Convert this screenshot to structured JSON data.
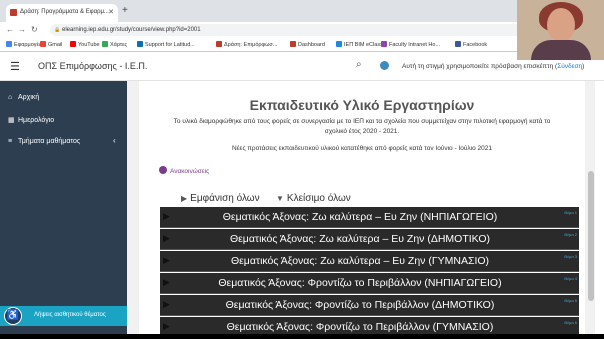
{
  "browser": {
    "tab_title": "Δράση: Προγράμματα & Εφαρμ...",
    "url": "elearning.iep.edu.gr/study/course/view.php?id=2001",
    "bookmarks": [
      {
        "label": "Εφαρμογές",
        "color": "#4285f4"
      },
      {
        "label": "Gmail",
        "color": "#ea4335"
      },
      {
        "label": "YouTube",
        "color": "#ff0000"
      },
      {
        "label": "Χάρτες",
        "color": "#34a853"
      },
      {
        "label": "Support for Latitud...",
        "color": "#0b6fb8"
      },
      {
        "label": "Δράση: Επιμόρφωσ...",
        "color": "#c0392b"
      },
      {
        "label": "Dashboard",
        "color": "#c0392b"
      },
      {
        "label": "ΙΕΠ ΒΙΜ eClass",
        "color": "#1e88e5"
      },
      {
        "label": "Faculty Intranet Ho...",
        "color": "#8e44ad"
      },
      {
        "label": "Facebook",
        "color": "#3b5998"
      }
    ]
  },
  "header": {
    "site_title": "ΟΠΣ Επιμόρφωσης - Ι.Ε.Π.",
    "guest_text": "Αυτή τη στιγμή χρησιμοποιείτε πρόσβαση επισκέπτη (",
    "login_link": "Σύνδεση",
    "guest_close": ")"
  },
  "sidebar": {
    "items": [
      {
        "label": "Αρχική",
        "icon": "home-icon"
      },
      {
        "label": "Ημερολόγιο",
        "icon": "calendar-icon"
      },
      {
        "label": "Τμήματα μαθήματος",
        "icon": "sections-icon"
      }
    ],
    "bottom_label": "Λήψεις αισθητικού θέματος"
  },
  "main": {
    "title": "Εκπαιδευτικό Υλικό Εργαστηρίων",
    "intro": "Το υλικό διαμορφώθηκε από τους φορείς σε συνεργασία με το ΙΕΠ και τα σχολεία που συμμετείχαν στην πιλοτική εφαρμογή κατά το σχολικό έτος 2020 - 2021.",
    "intro2": "Νέες προτάσεις εκπαιδευτικού υλικού κατατέθηκε από φορείς κατά τον Ιούνιο - Ιούλιο 2021",
    "announcements": "Ανακοινώσεις",
    "expand_all": "Εμφάνιση όλων",
    "collapse_all": "Κλείσιμο όλων",
    "sections": [
      {
        "label": "Θεματικός Άξονας: Ζω καλύτερα – Ευ Ζην (ΝΗΠΙΑΓΩΓΕΙΟ)",
        "meta": "Θέμα 1"
      },
      {
        "label": "Θεματικός Άξονας: Ζω καλύτερα – Ευ Ζην (ΔΗΜΟΤΙΚΟ)",
        "meta": "Θέμα 2"
      },
      {
        "label": "Θεματικός Άξονας: Ζω καλύτερα – Ευ Ζην (ΓΥΜΝΑΣΙΟ)",
        "meta": "Θέμα 3"
      },
      {
        "label": "Θεματικός Άξονας: Φροντίζω το Περιβάλλον (ΝΗΠΙΑΓΩΓΕΙΟ)",
        "meta": "Θέμα 4"
      },
      {
        "label": "Θεματικός Άξονας: Φροντίζω το Περιβάλλον (ΔΗΜΟΤΙΚΟ)",
        "meta": "Θέμα 5"
      },
      {
        "label": "Θεματικός Άξονας: Φροντίζω το Περιβάλλον (ΓΥΜΝΑΣΙΟ)",
        "meta": "Θέμα 6"
      }
    ]
  },
  "colors": {
    "sidebar_bg": "#2c3e50",
    "section_bg": "#2a2a2a",
    "accent": "#1ba3c3"
  }
}
